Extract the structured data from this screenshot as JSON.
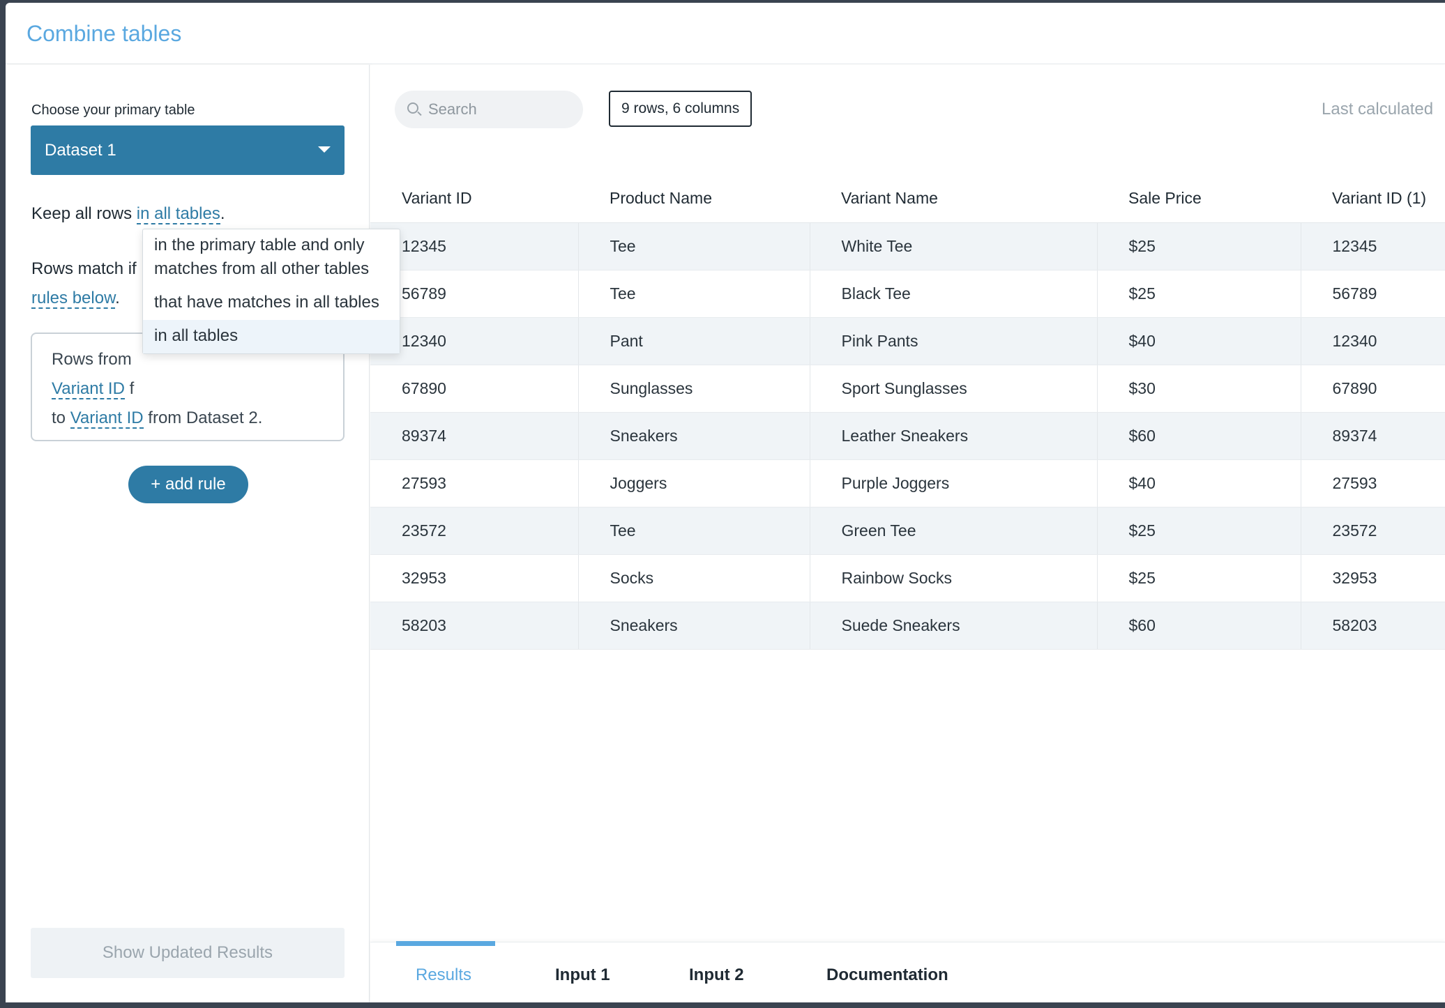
{
  "modal": {
    "title": "Combine tables"
  },
  "left": {
    "primary_label": "Choose your primary table",
    "primary_value": "Dataset 1",
    "keep_prefix": "Keep all rows ",
    "keep_link": "in all tables",
    "keep_suffix": ".",
    "match_prefix": "Rows match if",
    "match_link": "rules below",
    "match_suffix": ".",
    "rule": {
      "prefix": "Rows from",
      "field1": "Variant ID",
      "mid": " f",
      "to": "to ",
      "field2": "Variant ID",
      "suffix": " from Dataset 2."
    },
    "add_rule": "+ add rule",
    "show_updated": "Show Updated Results"
  },
  "dropdown": {
    "options": [
      "in the primary table and only matches from all other tables",
      "that have matches in all tables",
      "in all tables"
    ],
    "selected_index": 2
  },
  "main": {
    "search_placeholder": "Search",
    "rows_badge": "9 rows, 6 columns",
    "last_calculated": "Last calculated"
  },
  "table": {
    "columns": [
      "Variant ID",
      "Product Name",
      "Variant Name",
      "Sale Price",
      "Variant ID (1)"
    ],
    "rows": [
      [
        "12345",
        "Tee",
        "White Tee",
        "$25",
        "12345"
      ],
      [
        "56789",
        "Tee",
        "Black Tee",
        "$25",
        "56789"
      ],
      [
        "12340",
        "Pant",
        "Pink Pants",
        "$40",
        "12340"
      ],
      [
        "67890",
        "Sunglasses",
        "Sport Sunglasses",
        "$30",
        "67890"
      ],
      [
        "89374",
        "Sneakers",
        "Leather Sneakers",
        "$60",
        "89374"
      ],
      [
        "27593",
        "Joggers",
        "Purple Joggers",
        "$40",
        "27593"
      ],
      [
        "23572",
        "Tee",
        "Green Tee",
        "$25",
        "23572"
      ],
      [
        "32953",
        "Socks",
        "Rainbow Socks",
        "$25",
        "32953"
      ],
      [
        "58203",
        "Sneakers",
        "Suede Sneakers",
        "$60",
        "58203"
      ]
    ]
  },
  "tabs": [
    "Results",
    "Input 1",
    "Input 2",
    "Documentation"
  ],
  "active_tab": 0
}
